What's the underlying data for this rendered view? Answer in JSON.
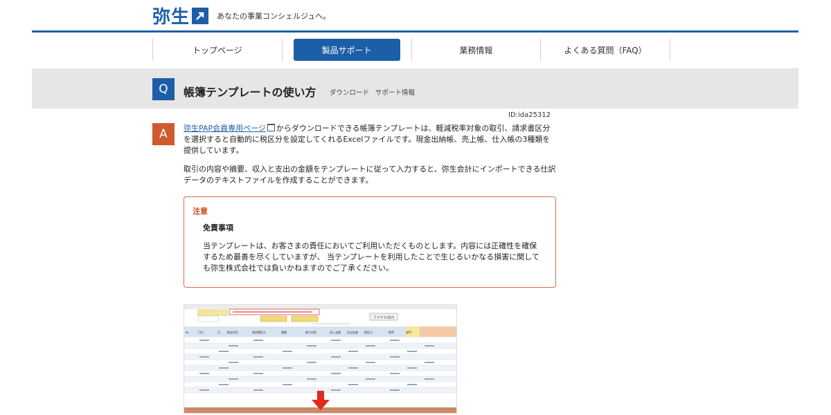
{
  "header": {
    "logo_text": "弥生",
    "logo_icon": "arrow-up-right-icon",
    "tagline": "あなたの事業コンシェルジュへ。",
    "brand_color": "#1d5ea8"
  },
  "nav": {
    "items": [
      {
        "label": "トップページ"
      },
      {
        "label": "製品サポート",
        "active": true
      },
      {
        "label": "業務情報"
      },
      {
        "label": "よくある質問（FAQ）"
      }
    ]
  },
  "question": {
    "icon_label": "Q",
    "title": "帳簿テンプレートの使い方",
    "tags": [
      "ダウンロード",
      "サポート情報"
    ]
  },
  "article": {
    "id": "ID:ida25312",
    "answer_label": "A",
    "link_text": "弥生PAP会員専用ページ",
    "para1_rest": "からダウンロードできる帳簿テンプレートは、軽減税率対象の取引、請求書区分を選択すると自動的に税区分を設定してくれるExcelファイルです。現金出納帳、売上帳、仕入帳の3種類を提供しています。",
    "para2": "取引の内容や摘要、収入と支出の金額をテンプレートに従って入力すると、弥生会計にインポートできる仕訳データのテキストファイルを作成することができます。"
  },
  "notice": {
    "title": "注意",
    "subtitle": "免責事項",
    "text": "当テンプレートは、お客さまの責任においてご利用いただくものとします。内容には正確性を確保するため最善を尽くしていますが、 当テンプレートを利用したことで生じるいかなる損害に関しても弥生株式会社では負いかねますのでご了承ください。",
    "accent_color": "#d86b48"
  },
  "spreadsheet": {
    "button_label": "ファイル出力",
    "headers": [
      "№",
      "日付",
      "日",
      "勘定科目",
      "請求書区分",
      "摘要",
      "取引内容",
      "収入金額",
      "支出金額",
      "税区分",
      "税率",
      "部門"
    ],
    "arrow_color": "#e02a1a"
  }
}
